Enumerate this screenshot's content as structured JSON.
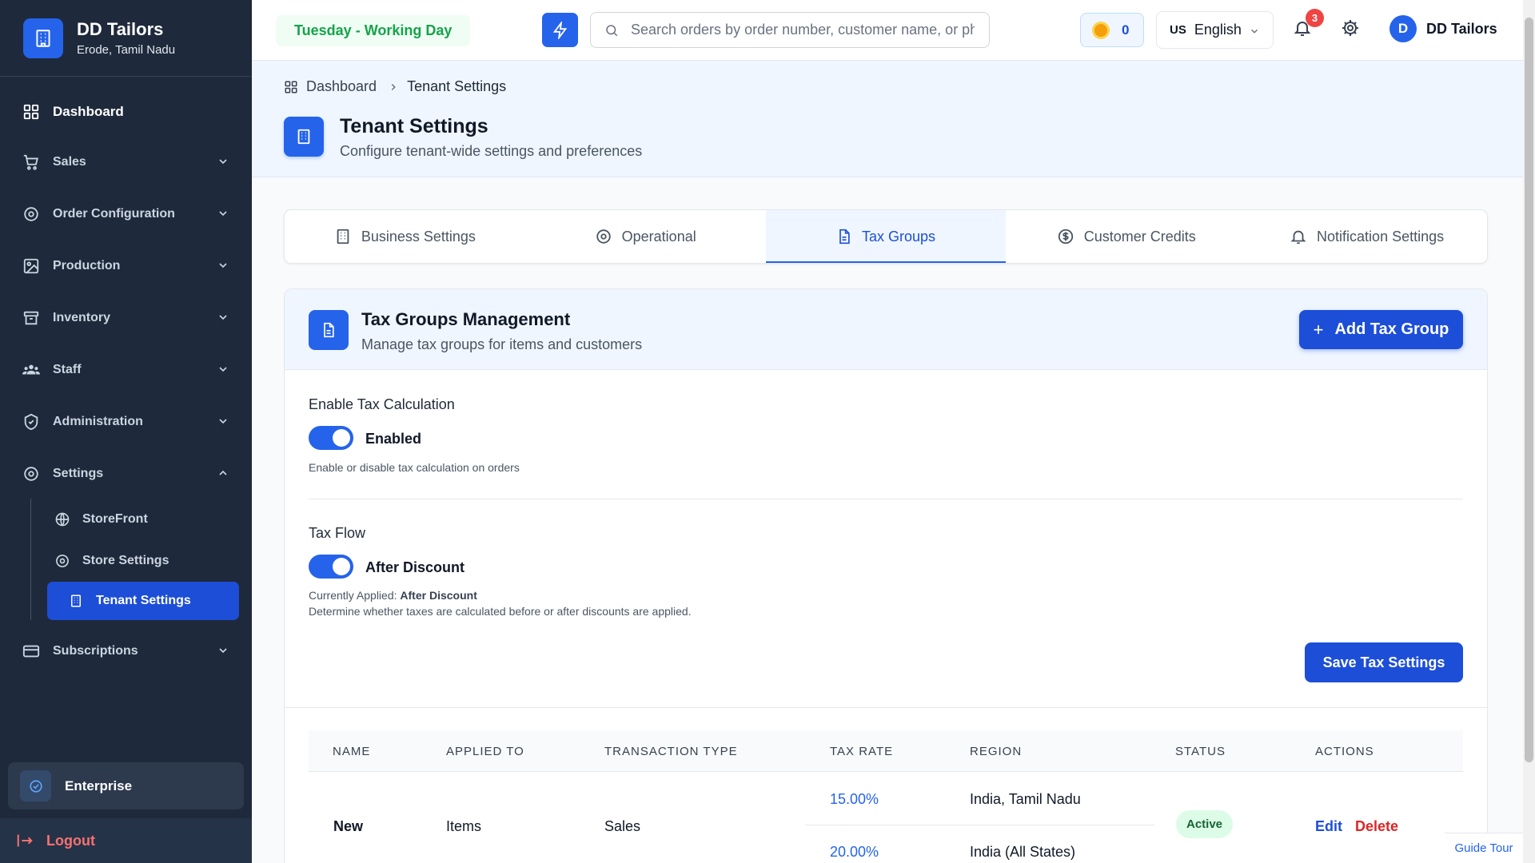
{
  "brand": {
    "name": "DD Tailors",
    "location": "Erode, Tamil Nadu"
  },
  "sidebar": {
    "dashboard": "Dashboard",
    "items": [
      {
        "label": "Sales",
        "icon": "cart-icon"
      },
      {
        "label": "Order Configuration",
        "icon": "gear-icon"
      },
      {
        "label": "Production",
        "icon": "image-icon"
      },
      {
        "label": "Inventory",
        "icon": "archive-icon"
      },
      {
        "label": "Staff",
        "icon": "users-icon"
      },
      {
        "label": "Administration",
        "icon": "shield-icon"
      },
      {
        "label": "Settings",
        "icon": "gear-icon",
        "expanded": true
      },
      {
        "label": "Subscriptions",
        "icon": "card-icon"
      }
    ],
    "settings_sub": [
      "StoreFront",
      "Store Settings",
      "Tenant Settings"
    ],
    "plan": "Enterprise",
    "logout": "Logout"
  },
  "header": {
    "day_status": "Tuesday - Working Day",
    "search_placeholder": "Search orders by order number, customer name, or phone",
    "coins": "0",
    "language_flag": "US",
    "language": "English",
    "notification_count": "3",
    "user_initial": "D",
    "user_name": "DD Tailors"
  },
  "breadcrumb": {
    "home": "Dashboard",
    "current": "Tenant Settings"
  },
  "page": {
    "title": "Tenant Settings",
    "subtitle": "Configure tenant-wide settings and preferences"
  },
  "tabs": [
    {
      "label": "Business Settings",
      "icon": "building-icon",
      "active": false
    },
    {
      "label": "Operational",
      "icon": "gear-icon",
      "active": false
    },
    {
      "label": "Tax Groups",
      "icon": "document-icon",
      "active": true
    },
    {
      "label": "Customer Credits",
      "icon": "dollar-icon",
      "active": false
    },
    {
      "label": "Notification Settings",
      "icon": "bell-icon",
      "active": false
    }
  ],
  "card": {
    "title": "Tax Groups Management",
    "subtitle": "Manage tax groups for items and customers",
    "add_button": "Add Tax Group",
    "enable_label": "Enable Tax Calculation",
    "enable_state": "Enabled",
    "enable_help": "Enable or disable tax calculation on orders",
    "flow_label": "Tax Flow",
    "flow_state": "After Discount",
    "flow_applied_prefix": "Currently Applied:",
    "flow_applied_value": "After Discount",
    "flow_help": "Determine whether taxes are calculated before or after discounts are applied.",
    "save_button": "Save Tax Settings"
  },
  "table": {
    "columns": [
      "NAME",
      "APPLIED TO",
      "TRANSACTION TYPE",
      "TAX RATE",
      "REGION",
      "STATUS",
      "ACTIONS"
    ],
    "row": {
      "name": "New",
      "applied_to": "Items",
      "transaction_type": "Sales",
      "rates": [
        {
          "rate": "15.00%",
          "region": "India, Tamil Nadu"
        },
        {
          "rate": "20.00%",
          "region": "India (All States)"
        }
      ],
      "status": "Active",
      "edit": "Edit",
      "delete": "Delete"
    }
  },
  "guide_tour": "Guide Tour",
  "colors": {
    "primary": "#2563eb",
    "sidebar": "#1e293b",
    "success": "#16a34a",
    "danger": "#dc2626"
  }
}
